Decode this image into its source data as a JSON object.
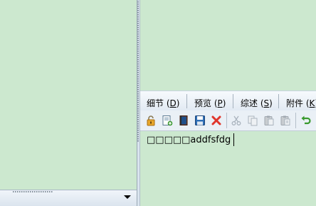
{
  "tabs": [
    {
      "label": "细节 (",
      "key": "D",
      "suffix": ")"
    },
    {
      "label": "预览 (",
      "key": "P",
      "suffix": ")"
    },
    {
      "label": "综述 (",
      "key": "S",
      "suffix": ")"
    },
    {
      "label": "附件 (",
      "key": "K",
      "suffix": ")"
    }
  ],
  "toolbar": {
    "icons": [
      "lock-icon",
      "new-document-icon",
      "book-icon",
      "save-icon",
      "delete-icon",
      "cut-icon",
      "copy-icon",
      "paste-icon",
      "paste-special-icon",
      "undo-icon"
    ],
    "colors": {
      "background": "#eaf0f6",
      "delete": "#e0352b",
      "undo": "#3a9a2e"
    }
  },
  "editor": {
    "text": "□□□□□addfsfdg"
  },
  "colors": {
    "pane_background": "#cce8cf",
    "border": "#9aa8b4"
  }
}
